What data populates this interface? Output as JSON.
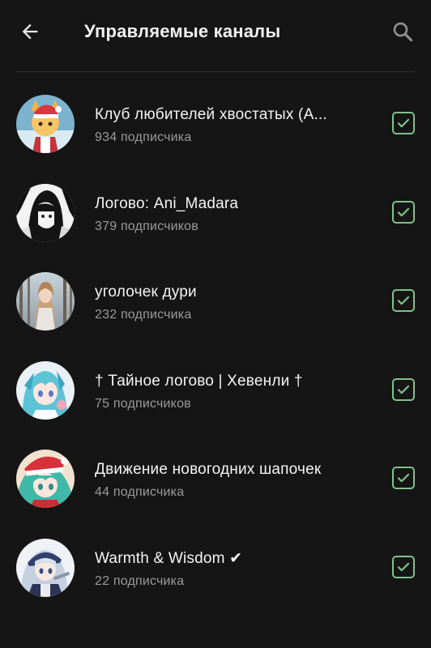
{
  "header": {
    "title": "Управляемые каналы"
  },
  "icons": {
    "back": "arrow-left-icon",
    "search": "search-icon",
    "checkbox": "check-icon"
  },
  "colors": {
    "background": "#151515",
    "accent_check": "#7fc18b",
    "subtitle": "#9a9a9a"
  },
  "channels": [
    {
      "name": "Клуб любителей хвостатых (А...",
      "subscribers": "934 подписчика",
      "checked": true
    },
    {
      "name": "Логово: Ani_Madara",
      "subscribers": "379 подписчиков",
      "checked": true
    },
    {
      "name": "уголочек дури",
      "subscribers": "232 подписчика",
      "checked": true
    },
    {
      "name": "† Тайное логово | Хевенли †",
      "subscribers": "75 подписчиков",
      "checked": true
    },
    {
      "name": "Движение новогодних шапочек",
      "subscribers": "44 подписчика",
      "checked": true
    },
    {
      "name": "Warmth & Wisdom ✔",
      "subscribers": "22 подписчика",
      "checked": true
    }
  ]
}
